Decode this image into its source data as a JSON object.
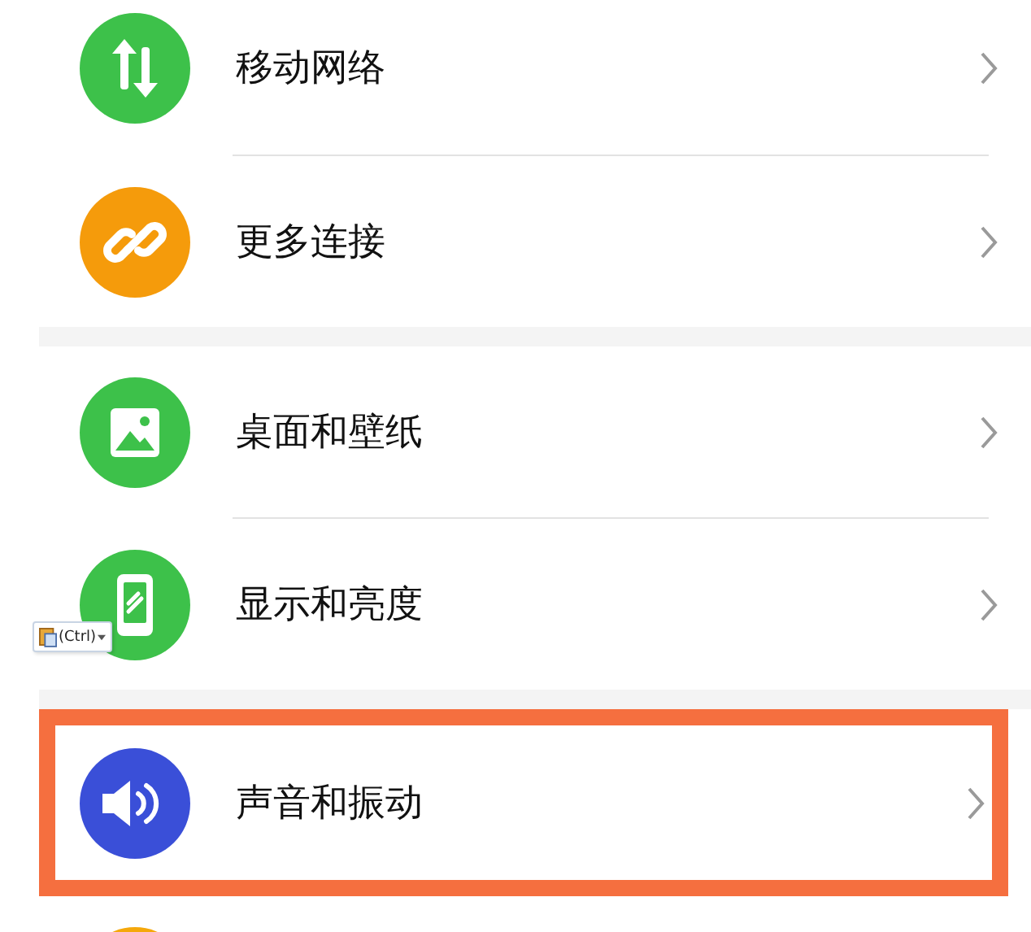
{
  "groups": [
    {
      "items": [
        {
          "kind": "mobile-data",
          "label": "移动网络",
          "color": "#3dc14a",
          "highlighted": false
        },
        {
          "kind": "link",
          "label": "更多连接",
          "color": "#f59b0b",
          "highlighted": false
        }
      ]
    },
    {
      "items": [
        {
          "kind": "wallpaper",
          "label": "桌面和壁纸",
          "color": "#3dc14a",
          "highlighted": false
        },
        {
          "kind": "display",
          "label": "显示和亮度",
          "color": "#3dc14a",
          "highlighted": false
        }
      ]
    },
    {
      "items": [
        {
          "kind": "sound",
          "label": "声音和振动",
          "color": "#3a4fd8",
          "highlighted": true
        },
        {
          "kind": "partial",
          "color": "#f5a80b",
          "highlighted": false
        }
      ]
    }
  ],
  "paste_options": {
    "label": "(Ctrl)"
  }
}
